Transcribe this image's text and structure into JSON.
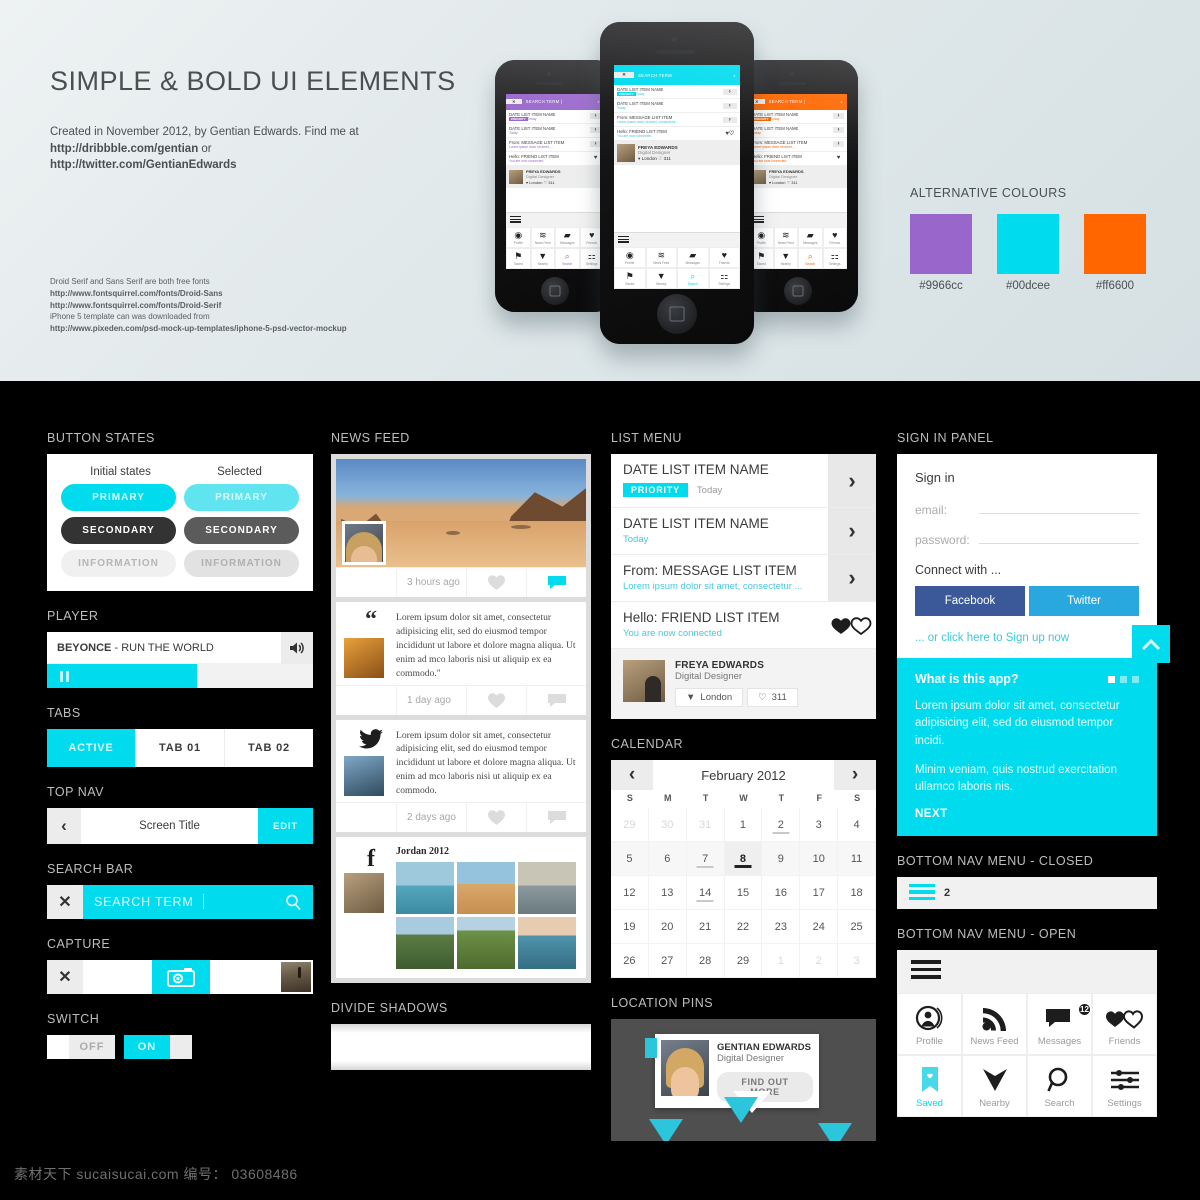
{
  "header": {
    "title": "SIMPLE & BOLD UI ELEMENTS",
    "credit_line1": "Created in November 2012, by Gentian Edwards. Find me at",
    "credit_link1": "http://dribbble.com/gentian",
    "credit_or": " or",
    "credit_link2": "http://twitter.com/GentianEdwards",
    "fonts_note": "Droid Serif and Sans Serif are both free fonts",
    "fonts_link1": "http://www.fontsquirrel.com/fonts/Droid-Sans",
    "fonts_link2": "http://www.fontsquirrel.com/fonts/Droid-Serif",
    "iphone_note": "iPhone 5 template can was downloaded from",
    "iphone_link": "http://www.pixeden.com/psd-mock-up-templates/iphone-5-psd-vector-mockup"
  },
  "alt_colours": {
    "title": "ALTERNATIVE COLOURS",
    "swatches": [
      {
        "hex": "#9966cc"
      },
      {
        "hex": "#00dcee"
      },
      {
        "hex": "#ff6600"
      }
    ]
  },
  "phone_mock": {
    "search_term": "SEARCH TERM",
    "rows": [
      {
        "title": "DATE LIST ITEM NAME",
        "badge": "PRIORITY",
        "sub": "Today"
      },
      {
        "title": "DATE LIST ITEM NAME",
        "badge": "",
        "sub": "Today"
      },
      {
        "title": "From: MESSAGE LIST ITEM",
        "badge": "",
        "sub": "Lorem ipsum dolor sit amet, consectetur ..."
      },
      {
        "title": "Hello: FRIEND LIST ITEM",
        "badge": "",
        "sub": "You are now connected"
      }
    ],
    "person_name": "FREYA EDWARDS",
    "person_role": "Digital Designer",
    "tag_location": "London",
    "tag_likes": "311",
    "nav": [
      "Profile",
      "News Feed",
      "Messages",
      "Friends",
      "Saved",
      "Nearby",
      "Search",
      "Settings"
    ]
  },
  "button_states": {
    "label": "BUTTON STATES",
    "col_initial": "Initial states",
    "col_selected": "Selected",
    "rows": [
      "PRIMARY",
      "SECONDARY",
      "INFORMATION"
    ]
  },
  "player": {
    "label": "PLAYER",
    "artist": "BEYONCE",
    "separator": " - ",
    "track": "RUN THE WORLD"
  },
  "tabs": {
    "label": "TABS",
    "items": [
      "ACTIVE",
      "TAB 01",
      "TAB 02"
    ]
  },
  "topnav": {
    "label": "TOP NAV",
    "title": "Screen Title",
    "edit": "EDIT"
  },
  "searchbar": {
    "label": "SEARCH BAR",
    "term": "SEARCH TERM"
  },
  "capture": {
    "label": "CAPTURE"
  },
  "switch": {
    "label": "SWITCH",
    "off": "OFF",
    "on": "ON"
  },
  "newsfeed": {
    "label": "NEWS FEED",
    "cards": [
      {
        "time": "3 hours ago"
      },
      {
        "text": "Lorem ipsum dolor sit amet, consectetur adipisicing elit, sed do eiusmod tempor incididunt ut labore et dolore magna aliqua. Ut enim ad mco laboris nisi ut aliquip ex ea commodo.\"",
        "time": "1 day ago"
      },
      {
        "text": "Lorem ipsum dolor sit amet, consectetur adipisicing elit, sed do eiusmod tempor incididunt ut labore et dolore magna aliqua. Ut enim ad mco laboris nisi ut aliquip ex ea commodo.",
        "time": "2 days ago"
      },
      {
        "album_title": "Jordan 2012"
      }
    ]
  },
  "divide_shadows": {
    "label": "DIVIDE SHADOWS"
  },
  "listmenu": {
    "label": "LIST MENU",
    "rows": [
      {
        "title": "DATE LIST ITEM NAME",
        "badge": "PRIORITY",
        "sub": "Today"
      },
      {
        "title": "DATE LIST ITEM NAME",
        "badge": "",
        "sub": "Today"
      },
      {
        "title": "From: MESSAGE LIST ITEM",
        "badge": "",
        "sub": "Lorem ipsum dolor sit amet, consectetur ..."
      },
      {
        "title": "Hello: FRIEND LIST ITEM",
        "badge": "",
        "sub": "You are now connected"
      }
    ],
    "person_name": "FREYA EDWARDS",
    "person_role": "Digital Designer",
    "tag_location": "London",
    "tag_likes": "311"
  },
  "calendar": {
    "label": "CALENDAR",
    "month": "February 2012",
    "dow": [
      "S",
      "M",
      "T",
      "W",
      "T",
      "F",
      "S"
    ],
    "weeks": [
      [
        {
          "d": "29",
          "mute": true
        },
        {
          "d": "30",
          "mute": true
        },
        {
          "d": "31",
          "mute": true
        },
        {
          "d": "1"
        },
        {
          "d": "2",
          "mark": true
        },
        {
          "d": "3"
        },
        {
          "d": "4"
        }
      ],
      [
        {
          "d": "5"
        },
        {
          "d": "6"
        },
        {
          "d": "7",
          "mark": true
        },
        {
          "d": "8",
          "sel": true
        },
        {
          "d": "9"
        },
        {
          "d": "10"
        },
        {
          "d": "11"
        }
      ],
      [
        {
          "d": "12"
        },
        {
          "d": "13"
        },
        {
          "d": "14",
          "mark": true
        },
        {
          "d": "15"
        },
        {
          "d": "16"
        },
        {
          "d": "17"
        },
        {
          "d": "18"
        }
      ],
      [
        {
          "d": "19"
        },
        {
          "d": "20"
        },
        {
          "d": "21"
        },
        {
          "d": "22"
        },
        {
          "d": "23"
        },
        {
          "d": "24"
        },
        {
          "d": "25"
        }
      ],
      [
        {
          "d": "26"
        },
        {
          "d": "27"
        },
        {
          "d": "28"
        },
        {
          "d": "29"
        },
        {
          "d": "1",
          "mute": true
        },
        {
          "d": "2",
          "mute": true
        },
        {
          "d": "3",
          "mute": true
        }
      ]
    ]
  },
  "location_pins": {
    "label": "LOCATION PINS",
    "name": "GENTIAN EDWARDS",
    "role": "Digital Designer",
    "button": "FIND OUT MORE"
  },
  "signin": {
    "label": "SIGN IN PANEL",
    "heading": "Sign in",
    "email_label": "email:",
    "password_label": "password:",
    "connect_with": "Connect with ...",
    "facebook": "Facebook",
    "twitter": "Twitter",
    "foot_prefix": "... or click here to ",
    "foot_link": "Sign up now"
  },
  "app_panel": {
    "heading": "What is this app?",
    "paragraph1": "Lorem ipsum dolor sit amet, consectetur adipisicing elit, sed do eiusmod tempor incidi.",
    "paragraph2": "Minim veniam, quis nostrud exercitation ullamco laboris nis.",
    "next": "NEXT"
  },
  "bottom_nav_closed": {
    "label": "BOTTOM NAV MENU - CLOSED",
    "count": "2"
  },
  "bottom_nav_open": {
    "label": "BOTTOM NAV MENU - OPEN",
    "items": [
      {
        "label": "Profile",
        "badge": ""
      },
      {
        "label": "News Feed",
        "badge": ""
      },
      {
        "label": "Messages",
        "badge": "12"
      },
      {
        "label": "Friends",
        "badge": ""
      },
      {
        "label": "Saved",
        "badge": ""
      },
      {
        "label": "Nearby",
        "badge": ""
      },
      {
        "label": "Search",
        "badge": ""
      },
      {
        "label": "Settings",
        "badge": ""
      }
    ]
  },
  "footer": {
    "watermark": "素材天下 sucaisucai.com  编号： 03608486"
  }
}
